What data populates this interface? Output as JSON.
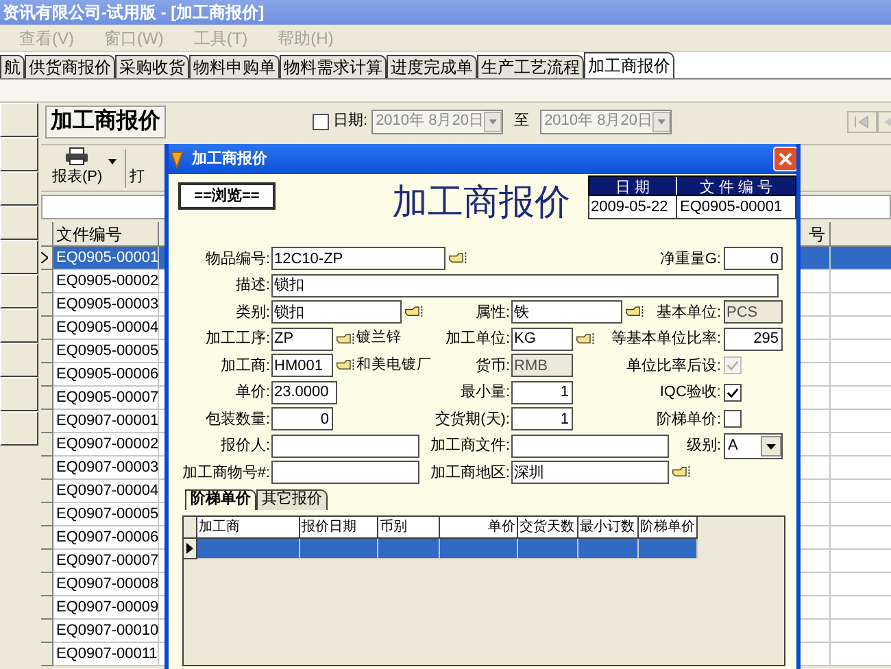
{
  "window": {
    "title": "资讯有限公司-试用版 - [加工商报价]"
  },
  "menu": [
    {
      "label": "查看(V)",
      "disabled": true
    },
    {
      "label": "窗口(W)",
      "disabled": true
    },
    {
      "label": "工具(T)",
      "disabled": true
    },
    {
      "label": "帮助(H)",
      "disabled": true
    }
  ],
  "tabs": [
    {
      "label": "航",
      "selected": false
    },
    {
      "label": "供货商报价",
      "selected": false
    },
    {
      "label": "采购收货",
      "selected": false
    },
    {
      "label": "物料申购单",
      "selected": false
    },
    {
      "label": "物料需求计算",
      "selected": false
    },
    {
      "label": "进度完成单",
      "selected": false
    },
    {
      "label": "生产工艺流程",
      "selected": false
    },
    {
      "label": "加工商报价",
      "selected": true
    }
  ],
  "module": {
    "title": "加工商报价",
    "date_filter": {
      "checked": false,
      "label": "日期:",
      "from": "2010年 8月20日",
      "separator": "至",
      "to": "2010年 8月20日"
    }
  },
  "toolbar": {
    "report_button": "报表(P)",
    "button_2": "打"
  },
  "list": {
    "columns": [
      "文件编号",
      "号"
    ],
    "rows": [
      {
        "cells": [
          "EQ0905-00001"
        ],
        "selected": true
      },
      {
        "cells": [
          "EQ0905-00002"
        ],
        "selected": false
      },
      {
        "cells": [
          "EQ0905-00003"
        ],
        "selected": false
      },
      {
        "cells": [
          "EQ0905-00004"
        ],
        "selected": false
      },
      {
        "cells": [
          "EQ0905-00005"
        ],
        "selected": false
      },
      {
        "cells": [
          "EQ0905-00006"
        ],
        "selected": false
      },
      {
        "cells": [
          "EQ0905-00007"
        ],
        "selected": false
      },
      {
        "cells": [
          "EQ0907-00001"
        ],
        "selected": false
      },
      {
        "cells": [
          "EQ0907-00002"
        ],
        "selected": false
      },
      {
        "cells": [
          "EQ0907-00003"
        ],
        "selected": false
      },
      {
        "cells": [
          "EQ0907-00004"
        ],
        "selected": false
      },
      {
        "cells": [
          "EQ0907-00005"
        ],
        "selected": false
      },
      {
        "cells": [
          "EQ0907-00006"
        ],
        "selected": false
      },
      {
        "cells": [
          "EQ0907-00007"
        ],
        "selected": false
      },
      {
        "cells": [
          "EQ0907-00008"
        ],
        "selected": false
      },
      {
        "cells": [
          "EQ0907-00009"
        ],
        "selected": false
      },
      {
        "cells": [
          "EQ0907-00010"
        ],
        "selected": false
      },
      {
        "cells": [
          "EQ0907-00011"
        ],
        "selected": false
      }
    ]
  },
  "dialog": {
    "title": "加工商报价",
    "mode": "==浏览==",
    "heading": "加工商报价",
    "doc_table": {
      "columns": [
        "日 期",
        "文 件 编 号"
      ],
      "values": [
        "2009-05-22",
        "EQ0905-00001"
      ]
    },
    "form": [
      {
        "left": {
          "label": "物品编号:",
          "kind": "lookup",
          "value": "12C10-ZP"
        },
        "right": {
          "label": "净重量G:",
          "kind": "number",
          "value": "0"
        }
      },
      {
        "left": {
          "label": "描述:",
          "kind": "text",
          "value": "锁扣"
        }
      },
      {
        "left": {
          "label": "类别:",
          "kind": "lookup",
          "value": "锁扣"
        },
        "middle": {
          "label": "属性:",
          "kind": "lookup",
          "value": "铁"
        },
        "right": {
          "label": "基本单位:",
          "kind": "readonly",
          "value": "PCS"
        }
      },
      {
        "left": {
          "label": "加工工序:",
          "kind": "lookup",
          "value": "ZP",
          "note": "镀兰锌"
        },
        "middle": {
          "label": "加工单位:",
          "kind": "lookup",
          "value": "KG"
        },
        "right": {
          "label": "等基本单位比率:",
          "kind": "number",
          "value": "295"
        }
      },
      {
        "left": {
          "label": "加工商:",
          "kind": "lookup",
          "value": "HM001",
          "note": "和美电镀厂"
        },
        "middle": {
          "label": "货币:",
          "kind": "readonly",
          "value": "RMB"
        },
        "right": {
          "label": "单位比率后设:",
          "kind": "checkbox",
          "checked": true,
          "disabled": true
        }
      },
      {
        "left": {
          "label": "单价:",
          "kind": "text",
          "value": "23.0000"
        },
        "middle": {
          "label": "最小量:",
          "kind": "number",
          "value": "1"
        },
        "right": {
          "label": "IQC验收:",
          "kind": "checkbox",
          "checked": true,
          "disabled": false
        }
      },
      {
        "left": {
          "label": "包装数量:",
          "kind": "number",
          "value": "0"
        },
        "middle": {
          "label": "交货期(天):",
          "kind": "number",
          "value": "1"
        },
        "right": {
          "label": "阶梯单价:",
          "kind": "checkbox",
          "checked": false,
          "disabled": false
        }
      },
      {
        "left": {
          "label": "报价人:",
          "kind": "text"
        },
        "middle": {
          "label": "加工商文件:",
          "kind": "text"
        },
        "right": {
          "label": "级别:",
          "kind": "combo",
          "value": "A"
        }
      },
      {
        "left": {
          "label": "加工商物号#:",
          "kind": "text"
        },
        "middle": {
          "label": "加工商地区:",
          "kind": "lookup",
          "value": "深圳"
        }
      }
    ],
    "tabs": [
      {
        "label": "阶梯单价",
        "selected": true
      },
      {
        "label": "其它报价",
        "selected": false
      }
    ],
    "grid": {
      "columns": [
        "加工商",
        "报价日期",
        "币别",
        "单价",
        "交货天数",
        "最小订数",
        "阶梯单价"
      ],
      "rows": [
        {
          "selected": true
        }
      ]
    }
  }
}
